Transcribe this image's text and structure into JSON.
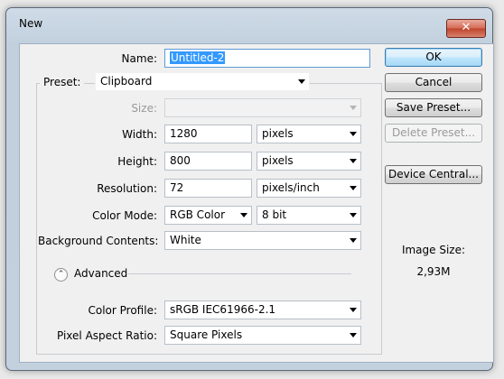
{
  "window": {
    "title": "New",
    "close_glyph": "✕"
  },
  "form": {
    "name_label": "Name:",
    "name_value": "Untitled-2",
    "preset_label": "Preset:",
    "preset_value": "Clipboard",
    "size_label": "Size:",
    "size_value": "",
    "width_label": "Width:",
    "width_value": "1280",
    "width_unit": "pixels",
    "height_label": "Height:",
    "height_value": "800",
    "height_unit": "pixels",
    "resolution_label": "Resolution:",
    "resolution_value": "72",
    "resolution_unit": "pixels/inch",
    "color_mode_label": "Color Mode:",
    "color_mode_value": "RGB Color",
    "bit_depth_value": "8 bit",
    "background_label": "Background Contents:",
    "background_value": "White",
    "advanced_label": "Advanced",
    "advanced_toggle_glyph": "⌃",
    "color_profile_label": "Color Profile:",
    "color_profile_value": "sRGB IEC61966-2.1",
    "pixel_aspect_label": "Pixel Aspect Ratio:",
    "pixel_aspect_value": "Square Pixels"
  },
  "buttons": {
    "ok": "OK",
    "cancel": "Cancel",
    "save_preset": "Save Preset...",
    "delete_preset": "Delete Preset...",
    "device_central": "Device Central..."
  },
  "info": {
    "image_size_label": "Image Size:",
    "image_size_value": "2,93M"
  },
  "colors": {
    "accent": "#3399ff",
    "titlebar": "#c2d0de",
    "close_button": "#c0432c"
  }
}
